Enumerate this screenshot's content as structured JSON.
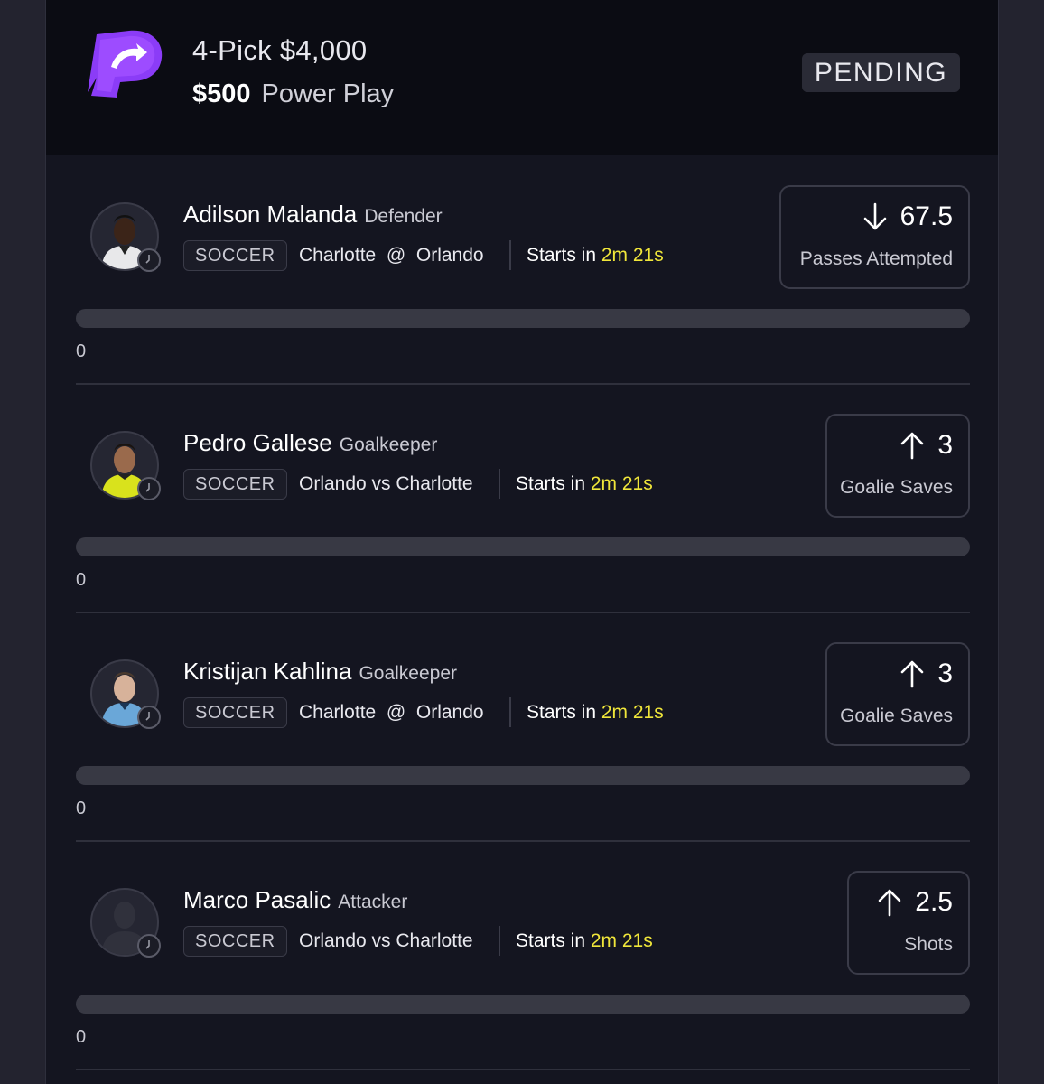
{
  "header": {
    "title": "4-Pick $4,000",
    "entry_amount": "$500",
    "play_type": "Power Play",
    "status": "PENDING",
    "brand_color": "#8b3cf7"
  },
  "picks": [
    {
      "player": "Adilson Malanda",
      "position": "Defender",
      "sport": "SOCCER",
      "matchup": "Charlotte  @  Orlando",
      "starts_label": "Starts in",
      "starts_time": "2m 21s",
      "direction": "down",
      "line": "67.5",
      "stat": "Passes Attempted",
      "progress_fraction": 0,
      "current_value": "0",
      "avatar": "player-photo-dark-jersey"
    },
    {
      "player": "Pedro Gallese",
      "position": "Goalkeeper",
      "sport": "SOCCER",
      "matchup": "Orlando vs Charlotte",
      "starts_label": "Starts in",
      "starts_time": "2m 21s",
      "direction": "up",
      "line": "3",
      "stat": "Goalie Saves",
      "progress_fraction": 0,
      "current_value": "0",
      "avatar": "player-photo-yellow-jersey"
    },
    {
      "player": "Kristijan Kahlina",
      "position": "Goalkeeper",
      "sport": "SOCCER",
      "matchup": "Charlotte  @  Orlando",
      "starts_label": "Starts in",
      "starts_time": "2m 21s",
      "direction": "up",
      "line": "3",
      "stat": "Goalie Saves",
      "progress_fraction": 0,
      "current_value": "0",
      "avatar": "player-photo-blue-jersey"
    },
    {
      "player": "Marco Pasalic",
      "position": "Attacker",
      "sport": "SOCCER",
      "matchup": "Orlando vs Charlotte",
      "starts_label": "Starts in",
      "starts_time": "2m 21s",
      "direction": "up",
      "line": "2.5",
      "stat": "Shots",
      "progress_fraction": 0,
      "current_value": "0",
      "avatar": "player-silhouette-placeholder"
    }
  ],
  "colors": {
    "countdown": "#f0e63a",
    "card_background": "#141520",
    "header_background": "#0b0c13"
  }
}
